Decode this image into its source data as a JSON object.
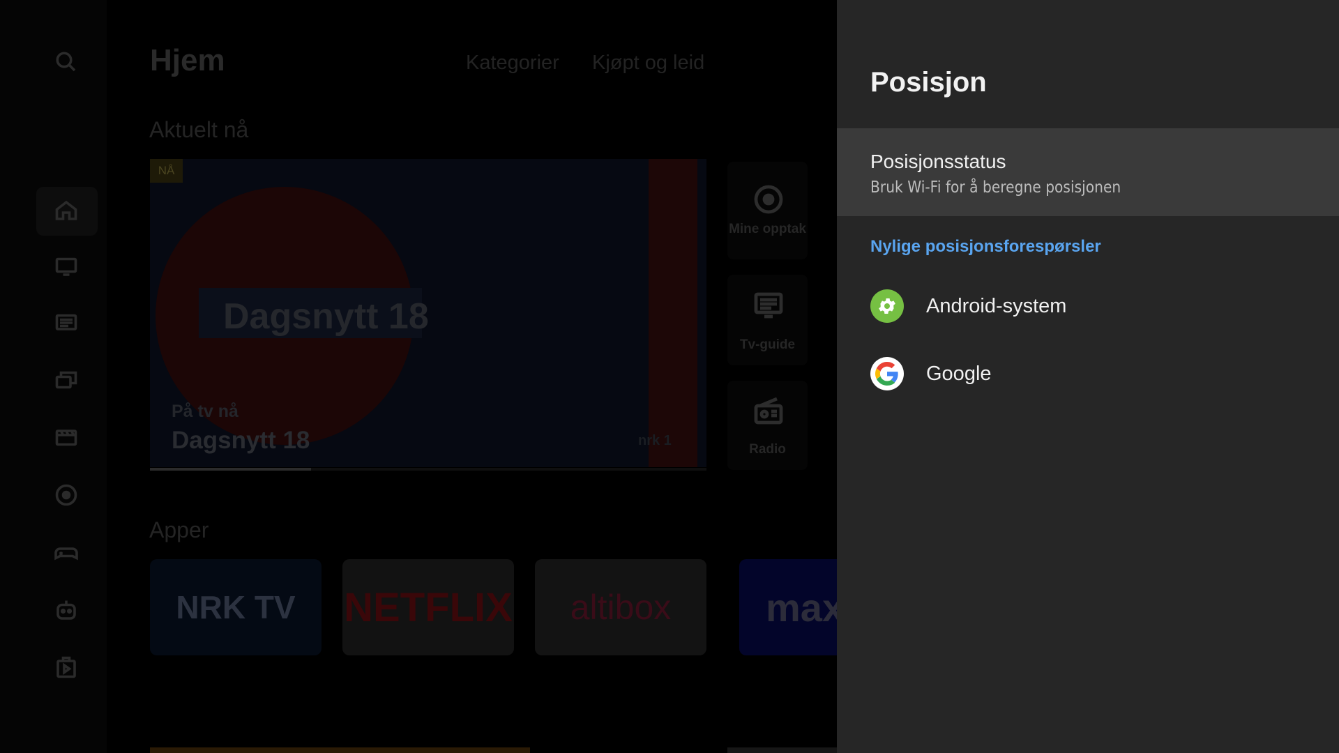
{
  "home": {
    "title": "Hjem",
    "tabs": [
      "Kategorier",
      "Kjøpt og leid"
    ],
    "section_now": "Aktuelt nå",
    "hero": {
      "badge": "NÅ",
      "overlay_title": "Dagsnytt 18",
      "subtitle": "På tv nå",
      "title": "Dagsnytt 18",
      "channel_logo": "nrk 1",
      "progress": 0.29
    },
    "tiles": [
      {
        "label": "Mine opptak",
        "icon": "record-icon"
      },
      {
        "label": "Tv-guide",
        "icon": "tv-guide-icon"
      },
      {
        "label": "Radio",
        "icon": "radio-icon"
      }
    ],
    "section_apps": "Apper",
    "apps": [
      {
        "name": "NRK TV",
        "text": "NRK TV"
      },
      {
        "name": "Netflix",
        "text": "NETFLIX"
      },
      {
        "name": "Altibox",
        "text": "altibox"
      },
      {
        "name": "Max",
        "text": "max"
      }
    ],
    "rail_icons": [
      "search-icon",
      "home-icon",
      "tv-icon",
      "guide-icon",
      "library-icon",
      "movies-icon",
      "recordings-icon",
      "games-icon",
      "kids-icon",
      "apps-icon"
    ]
  },
  "panel": {
    "title": "Posisjon",
    "status": {
      "title": "Posisjonsstatus",
      "subtitle": "Bruk Wi-Fi for å beregne posisjonen"
    },
    "recent_requests_label": "Nylige posisjonsforespørsler",
    "apps": [
      {
        "name": "Android-system",
        "icon": "android-settings-icon"
      },
      {
        "name": "Google",
        "icon": "google-icon"
      }
    ]
  },
  "colors": {
    "panel_bg": "#262626",
    "focus_bg": "#3a3a3a",
    "link": "#5aa5f0",
    "android_green": "#76c043"
  }
}
